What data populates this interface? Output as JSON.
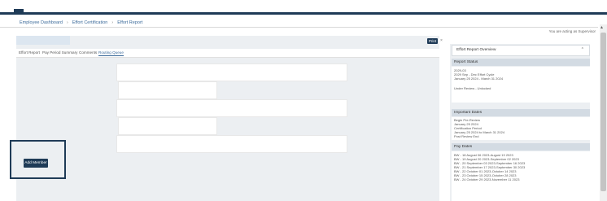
{
  "breadcrumb": {
    "items": [
      "Employee Dashboard",
      "Effort Certification",
      "Effort Report"
    ],
    "separator": "›"
  },
  "acting_as": "You are acting as Supervisor",
  "toolbar": {
    "print_label": "Print",
    "close_glyph": "×"
  },
  "tabs": [
    "Effort Report",
    "Pay Period Summary",
    "Comments",
    "Routing Queue"
  ],
  "active_tab": "Routing Queue",
  "add_member_label": "Add Member",
  "overview": {
    "title": "Effort Report Overview",
    "chevron": "⌃",
    "report_status": {
      "heading": "Report Status",
      "lines": [
        "2029-03",
        "2029 Sep - Dec Effort Cycle",
        "January 25 2024 - March 31 2024",
        "",
        "Under Review - Unlocked"
      ]
    },
    "important_dates": {
      "heading": "Important Dates",
      "lines": [
        "Begin Pre-Review",
        "January 25 2024",
        "Certification Period",
        "January 25 2024 to March 31 2024",
        "Post Review End"
      ]
    },
    "pay_dates": {
      "heading": "Pay Dates",
      "lines": [
        "BW - 18 August 06 2023-August 19 2023",
        "BW - 19 August 20 2023-September 02 2023",
        "BW - 20 September 03 2023-September 16 2023",
        "BW - 21 September 17 2023-September 30 2023",
        "BW - 22 October 01 2023-October 14 2023",
        "BW - 23 October 15 2023-October 28 2023",
        "BW - 24 October 29 2023-November 11 2023"
      ]
    }
  },
  "colors": {
    "navy": "#1f3b57",
    "link": "#3b6a9a",
    "panel_bg": "#eceff2"
  }
}
